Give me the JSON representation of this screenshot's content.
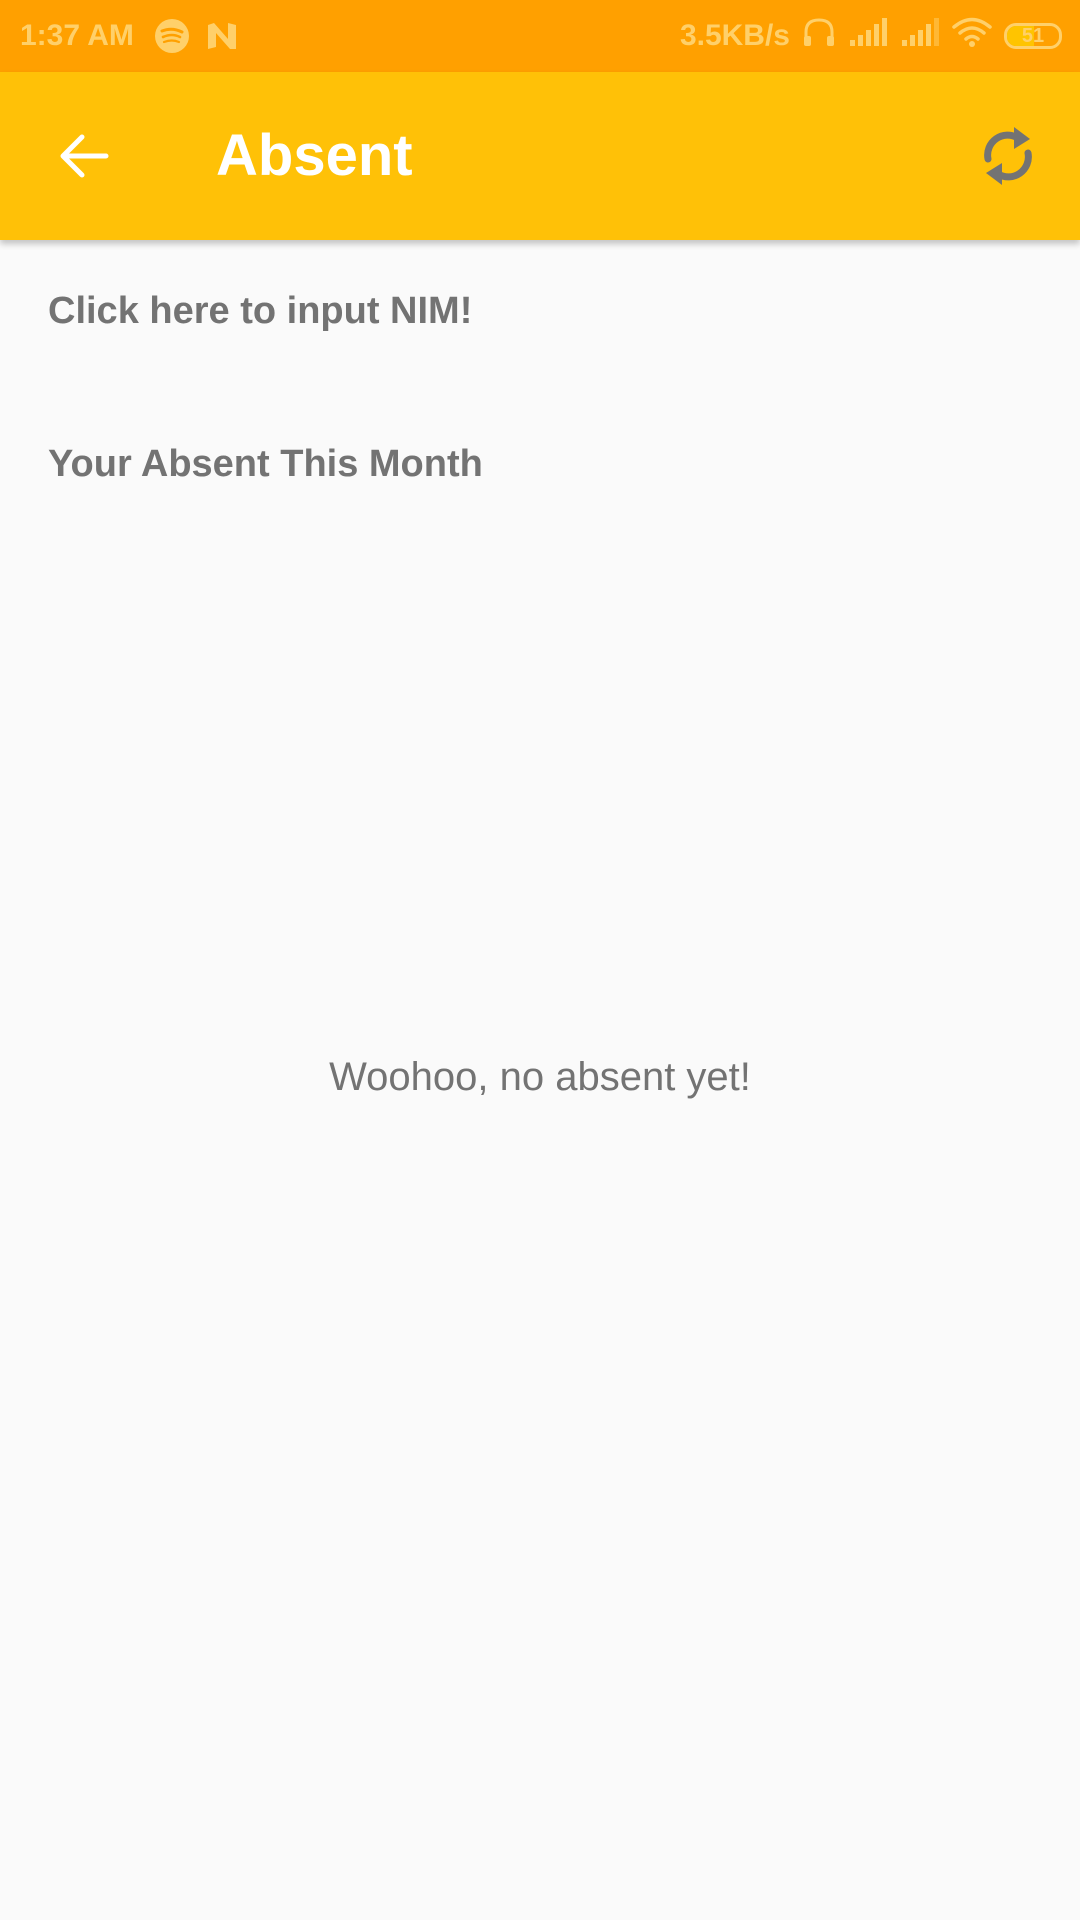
{
  "status_bar": {
    "time": "1:37 AM",
    "network_speed": "3.5KB/s",
    "battery_level": "51",
    "battery_fraction": 0.51,
    "icons": [
      "spotify-icon",
      "n-app-icon",
      "headphones-icon",
      "signal-icon",
      "signal-icon",
      "wifi-icon",
      "battery-icon"
    ]
  },
  "app_bar": {
    "title": "Absent",
    "back_icon": "arrow-back-icon",
    "refresh_icon": "refresh-icon"
  },
  "content": {
    "nim_prompt": "Click here to input NIM!",
    "section_title": "Your Absent This Month",
    "empty_message": "Woohoo, no absent yet!"
  },
  "colors": {
    "status_bar": "#ffa000",
    "app_bar": "#ffc107",
    "text_gray": "#737373",
    "background": "#fafafa"
  }
}
